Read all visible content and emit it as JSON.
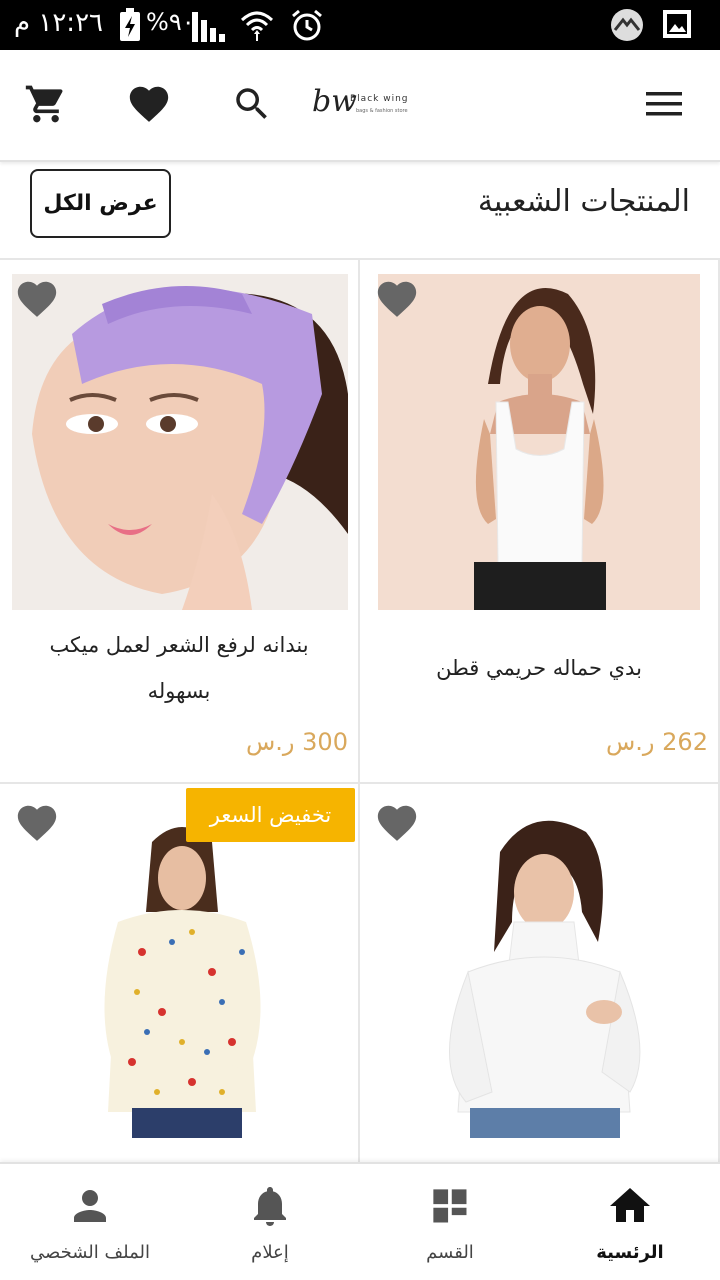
{
  "status_bar": {
    "time": "١٢:٢٦ م",
    "battery": "%٩٠",
    "icons": [
      "battery-charging-icon",
      "signal-icon",
      "wifi-icon",
      "alarm-icon",
      "cloud-app-icon",
      "gallery-icon"
    ]
  },
  "header": {
    "logo_mark": "bw",
    "logo_name": "Black wing",
    "logo_tagline": "bags & fashion store",
    "icons": [
      "cart-icon",
      "heart-icon",
      "search-icon",
      "menu-icon"
    ]
  },
  "section": {
    "title": "المنتجات الشعبية",
    "view_all_label": "عرض الكل"
  },
  "products": [
    {
      "name": "بدي حماله حريمي قطن",
      "price": "262 ر.س",
      "badge": ""
    },
    {
      "name": "بندانه لرفع الشعر لعمل ميكب بسهوله",
      "price": "300 ر.س",
      "badge": ""
    },
    {
      "name": "",
      "price": "",
      "badge": ""
    },
    {
      "name": "",
      "price": "",
      "badge": "تخفيض السعر"
    }
  ],
  "bottom_nav": {
    "items": [
      {
        "label": "الرئسية",
        "icon": "home-icon",
        "active": true
      },
      {
        "label": "القسم",
        "icon": "category-icon",
        "active": false
      },
      {
        "label": "إعلام",
        "icon": "bell-icon",
        "active": false
      },
      {
        "label": "الملف الشخصي",
        "icon": "profile-icon",
        "active": false
      }
    ]
  },
  "colors": {
    "price": "#d9a85c",
    "badge": "#f6b400",
    "favorite_icon": "#666666",
    "status_bar": "#000000"
  }
}
